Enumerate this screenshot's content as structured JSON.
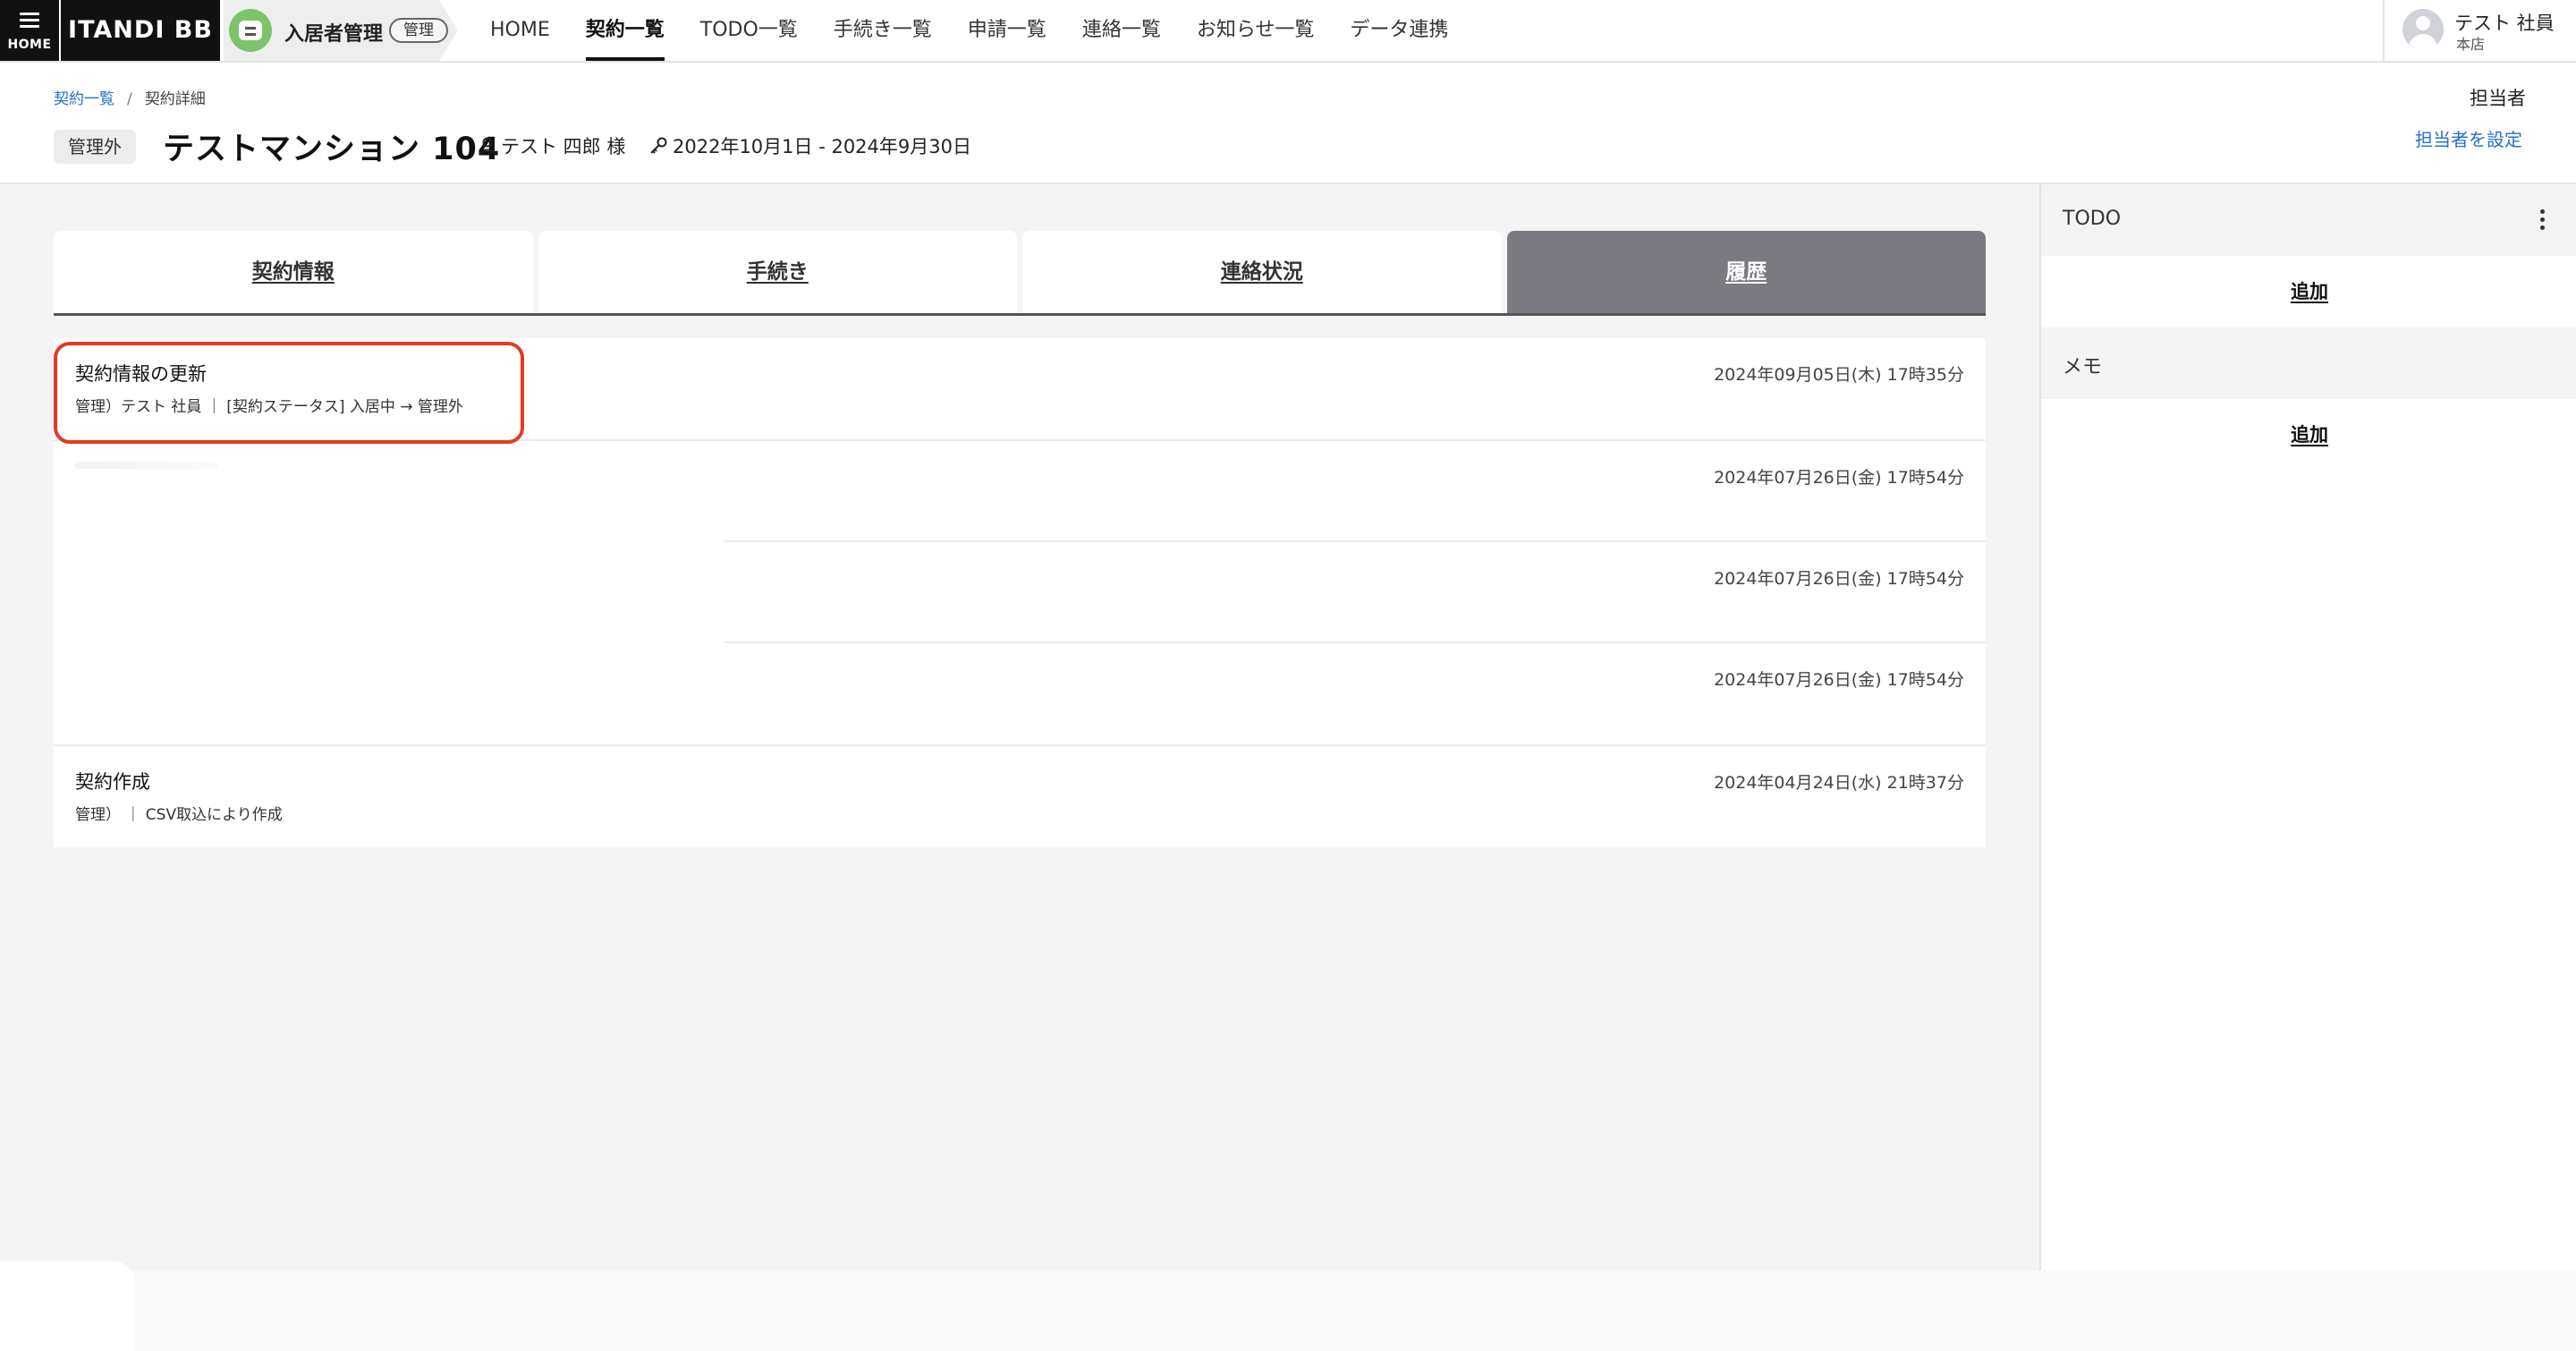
{
  "nav": {
    "home_label": "HOME",
    "brand": "ITANDI BB",
    "product_name": "入居者管理",
    "product_badge": "管理",
    "items": [
      {
        "label": "HOME"
      },
      {
        "label": "契約一覧"
      },
      {
        "label": "TODO一覧"
      },
      {
        "label": "手続き一覧"
      },
      {
        "label": "申請一覧"
      },
      {
        "label": "連絡一覧"
      },
      {
        "label": "お知らせ一覧"
      },
      {
        "label": "データ連携"
      }
    ],
    "active_index": 1
  },
  "user": {
    "name": "テスト 社員",
    "store": "本店"
  },
  "breadcrumb": {
    "list": "契約一覧",
    "sep": "/",
    "current": "契約詳細"
  },
  "contract": {
    "status": "管理外",
    "property": "テストマンション 104",
    "tenant": "テスト 四郎 様",
    "period": "2022年10月1日 - 2024年9月30日"
  },
  "assignee": {
    "label": "担当者",
    "set_link": "担当者を設定"
  },
  "tabs": [
    {
      "label": "契約情報"
    },
    {
      "label": "手続き"
    },
    {
      "label": "連絡状況"
    },
    {
      "label": "履歴"
    }
  ],
  "active_tab": 3,
  "history": [
    {
      "title": "契約情報の更新",
      "detail": "管理）テスト 社員 ｜ [契約ステータス] 入居中 → 管理外",
      "date": "2024年09月05日(木) 17時35分"
    },
    {
      "title": "",
      "detail": "",
      "date": "2024年07月26日(金) 17時54分"
    },
    {
      "title": "",
      "detail": "",
      "date": "2024年07月26日(金) 17時54分"
    },
    {
      "title": "",
      "detail": "",
      "date": "2024年07月26日(金) 17時54分"
    },
    {
      "title": "契約作成",
      "detail": "管理） ｜ CSV取込により作成",
      "date": "2024年04月24日(水) 21時37分"
    }
  ],
  "right_panel": {
    "todo": {
      "heading": "TODO",
      "add": "追加"
    },
    "memo": {
      "heading": "メモ",
      "add": "追加"
    }
  },
  "colors": {
    "highlight": "#e43a24",
    "link": "#2a6fc9",
    "active_tab": "#7a7a80"
  },
  "icons": [
    "hamburger-icon",
    "mascot-logo",
    "person-icon",
    "key-icon",
    "user-avatar-icon",
    "kebab-menu-icon"
  ]
}
